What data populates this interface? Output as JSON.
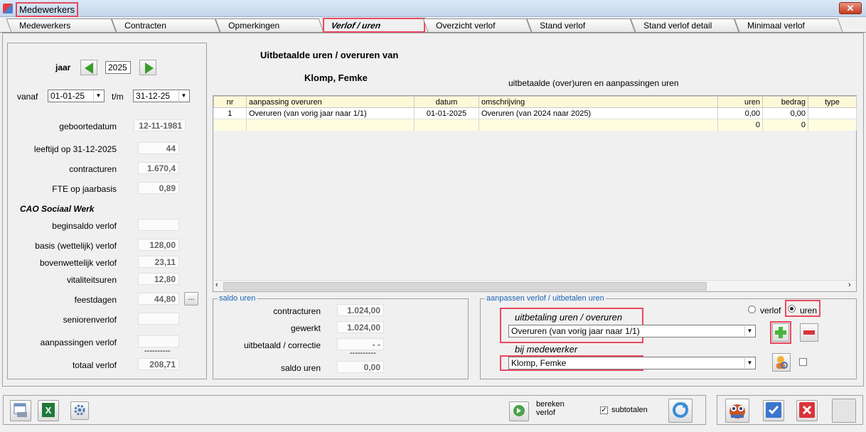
{
  "window": {
    "title": "Medewerkers",
    "close_label": "✕"
  },
  "tabs": [
    {
      "label": "Medewerkers"
    },
    {
      "label": "Contracten"
    },
    {
      "label": "Opmerkingen"
    },
    {
      "label": "Verlof / uren"
    },
    {
      "label": "Overzicht verlof"
    },
    {
      "label": "Stand verlof"
    },
    {
      "label": "Stand verlof detail"
    },
    {
      "label": "Minimaal verlof"
    }
  ],
  "left": {
    "jaar_label": "jaar",
    "jaar_value": "2025",
    "vanaf_label": "vanaf",
    "vanaf_value": "01-01-25",
    "tm_label": "t/m",
    "tm_value": "31-12-25",
    "fields": [
      {
        "label": "geboortedatum",
        "value": "12-11-1981"
      },
      {
        "label": "leeftijd op 31-12-2025",
        "value": "44"
      },
      {
        "label": "contracturen",
        "value": "1.670,4"
      },
      {
        "label": "FTE op jaarbasis",
        "value": "0,89"
      }
    ],
    "cao_title": "CAO Sociaal Werk",
    "verlof_fields": [
      {
        "label": "beginsaldo verlof",
        "value": ""
      },
      {
        "label": "basis (wettelijk) verlof",
        "value": "128,00"
      },
      {
        "label": "bovenwettelijk verlof",
        "value": "23,11"
      },
      {
        "label": "vitaliteitsuren",
        "value": "12,80"
      },
      {
        "label": "feestdagen",
        "value": "44,80"
      },
      {
        "label": "seniorenverlof",
        "value": ""
      },
      {
        "label": "aanpassingen verlof",
        "value": ""
      }
    ],
    "dash_line": "----------",
    "totaal_label": "totaal verlof",
    "totaal_value": "208,71",
    "ellipsis_label": "..."
  },
  "main": {
    "heading": "Uitbetaalde uren / overuren van",
    "employee_name": "Klomp, Femke",
    "grid_title": "uitbetaalde (over)uren en aanpassingen uren",
    "columns": [
      "nr",
      "aanpassing overuren",
      "datum",
      "omschrijving",
      "uren",
      "bedrag",
      "type"
    ],
    "rows": [
      [
        "1",
        "Overuren (van vorig jaar naar 1/1)",
        "01-01-2025",
        "Overuren (van 2024 naar 2025)",
        "0,00",
        "0,00",
        ""
      ]
    ],
    "totals_row": [
      "",
      "",
      "",
      "",
      "0",
      "0",
      ""
    ]
  },
  "saldo": {
    "title": "saldo uren",
    "fields": [
      {
        "label": "contracturen",
        "value": "1.024,00"
      },
      {
        "label": "gewerkt",
        "value": "1.024,00"
      },
      {
        "label": "uitbetaald / correctie",
        "value": "- -"
      }
    ],
    "dash_line": "----------",
    "saldo_label": "saldo uren",
    "saldo_value": "0,00"
  },
  "aanpassen": {
    "title": "aanpassen verlof / uitbetalen uren",
    "radio_verlof": "verlof",
    "radio_uren": "uren",
    "uitbetaling_label": "uitbetaling uren / overuren",
    "uitbetaling_value": "Overuren (van vorig jaar naar 1/1)",
    "bij_label": "bij medewerker",
    "medewerker_value": "Klomp, Femke"
  },
  "bottom": {
    "bereken_label1": "bereken",
    "bereken_label2": "verlof",
    "subtotalen_label": "subtotalen"
  }
}
